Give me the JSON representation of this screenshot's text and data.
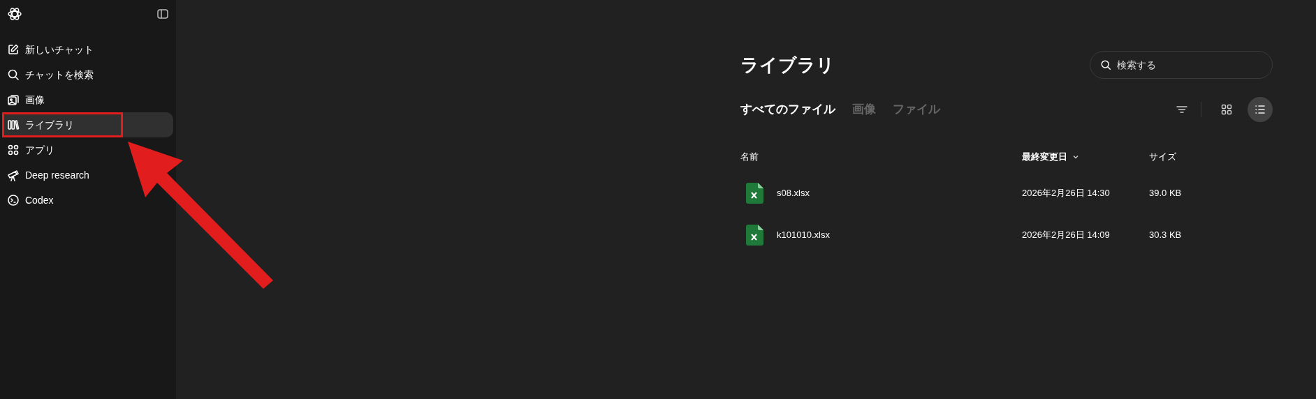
{
  "sidebar": {
    "items": [
      {
        "label": "新しいチャット",
        "selected": false
      },
      {
        "label": "チャットを検索",
        "selected": false
      },
      {
        "label": "画像",
        "selected": false
      },
      {
        "label": "ライブラリ",
        "selected": true
      },
      {
        "label": "アプリ",
        "selected": false
      },
      {
        "label": "Deep research",
        "selected": false
      },
      {
        "label": "Codex",
        "selected": false
      }
    ]
  },
  "library": {
    "title": "ライブラリ",
    "search": {
      "placeholder": "検索する"
    },
    "tabs": [
      {
        "label": "すべてのファイル",
        "selected": true
      },
      {
        "label": "画像",
        "selected": false
      },
      {
        "label": "ファイル",
        "selected": false
      }
    ],
    "views": [
      {
        "kind": "grid",
        "selected": false
      },
      {
        "kind": "list",
        "selected": true
      }
    ],
    "table": {
      "columns": [
        {
          "label": "名前",
          "sorted": false
        },
        {
          "label": "最終変更日",
          "sorted": true
        },
        {
          "label": "サイズ",
          "sorted": false
        }
      ],
      "rows": [
        {
          "name": "s08.xlsx",
          "modified": "2026年2月26日 14:30",
          "size": "39.0 KB"
        },
        {
          "name": "k101010.xlsx",
          "modified": "2026年2月26日 14:09",
          "size": "30.3 KB"
        }
      ]
    }
  }
}
